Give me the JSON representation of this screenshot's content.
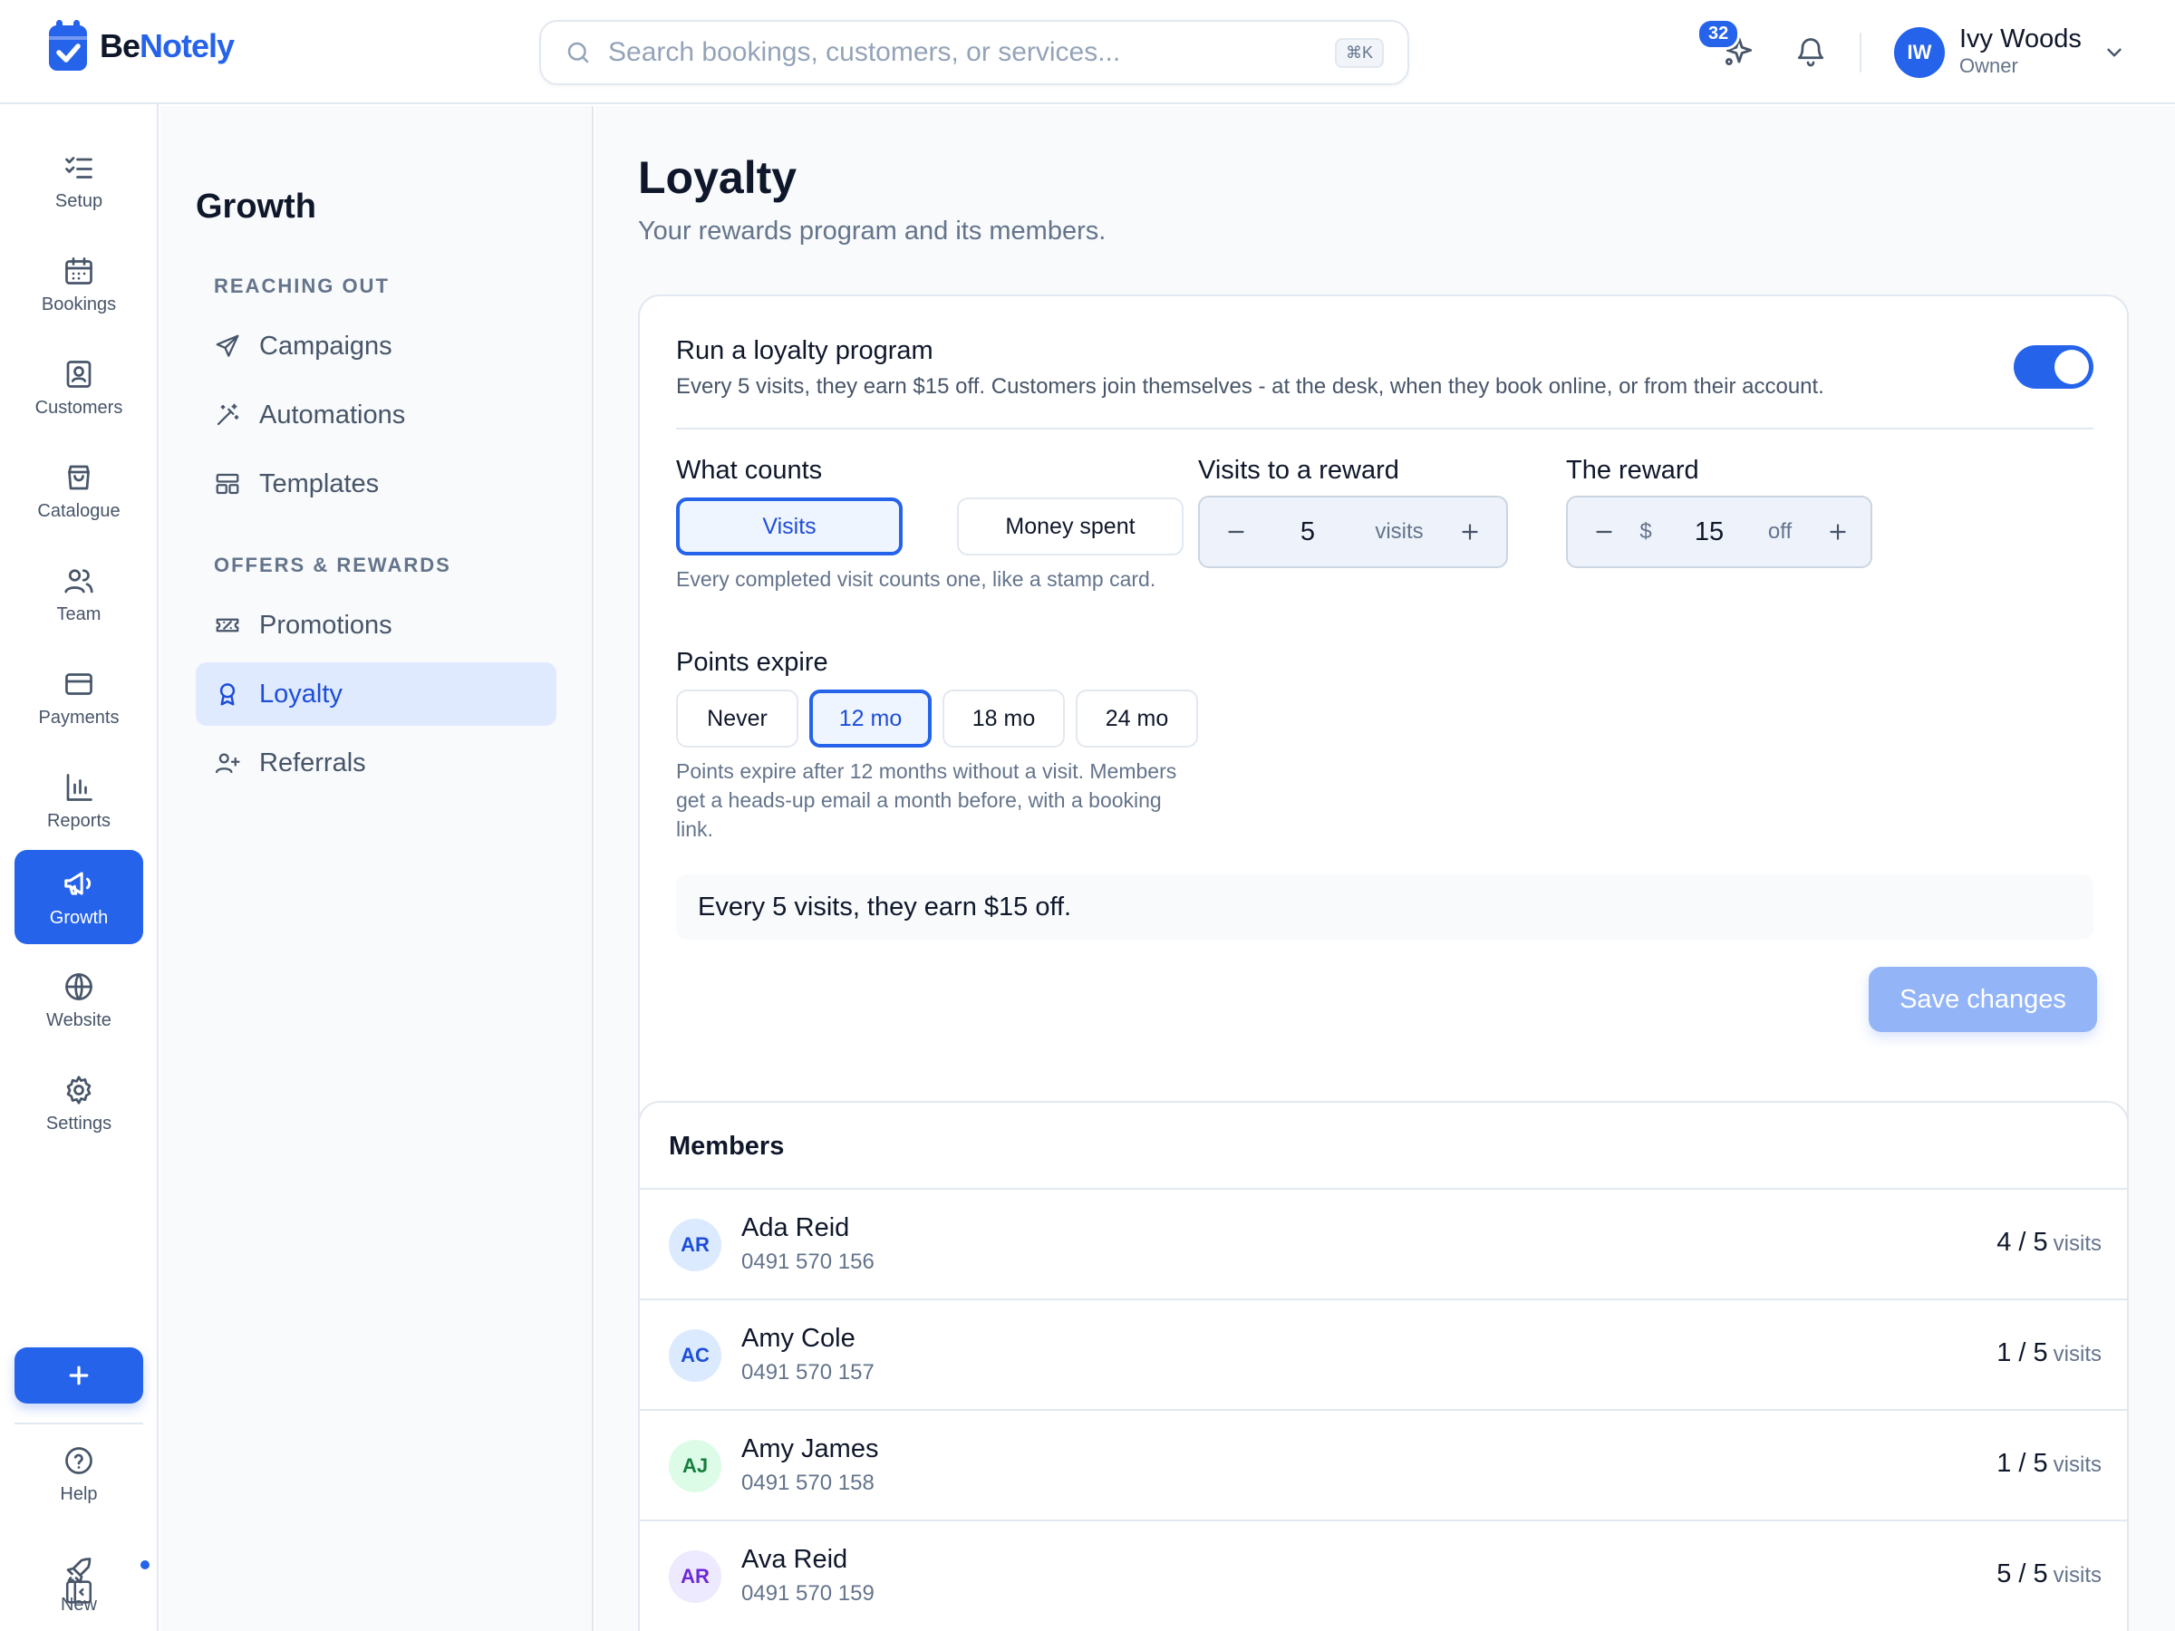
{
  "brand": {
    "name_part1": "Be",
    "name_part2": "Notely"
  },
  "search": {
    "placeholder": "Search bookings, customers, or services...",
    "shortcut": "⌘K"
  },
  "header": {
    "notification_count": "32",
    "user": {
      "initials": "IW",
      "name": "Ivy Woods",
      "role": "Owner"
    }
  },
  "rail": {
    "items": [
      {
        "label": "Setup",
        "icon": "checklist-icon"
      },
      {
        "label": "Bookings",
        "icon": "calendar-icon"
      },
      {
        "label": "Customers",
        "icon": "contact-card-icon"
      },
      {
        "label": "Catalogue",
        "icon": "shopping-bag-icon"
      },
      {
        "label": "Team",
        "icon": "users-icon"
      },
      {
        "label": "Payments",
        "icon": "credit-card-icon"
      },
      {
        "label": "Reports",
        "icon": "bar-chart-icon"
      },
      {
        "label": "Growth",
        "icon": "megaphone-icon",
        "active": true
      },
      {
        "label": "Website",
        "icon": "globe-icon"
      },
      {
        "label": "Settings",
        "icon": "gear-icon"
      }
    ],
    "help_label": "Help",
    "new_label": "New"
  },
  "subnav": {
    "title": "Growth",
    "sections": [
      {
        "label": "REACHING OUT",
        "items": [
          "Campaigns",
          "Automations",
          "Templates"
        ]
      },
      {
        "label": "OFFERS & REWARDS",
        "items": [
          "Promotions",
          "Loyalty",
          "Referrals"
        ]
      }
    ],
    "active": "Loyalty"
  },
  "page": {
    "title": "Loyalty",
    "subtitle": "Your rewards program and its members."
  },
  "program": {
    "title": "Run a loyalty program",
    "description": "Every 5 visits, they earn $15 off. Customers join themselves - at the desk, when they book online, or from their account.",
    "enabled": true,
    "what_counts": {
      "label": "What counts",
      "options": [
        "Visits",
        "Money spent"
      ],
      "selected": "Visits",
      "help": "Every completed visit counts one, like a stamp card."
    },
    "visits_to_reward": {
      "label": "Visits to a reward",
      "value": "5",
      "unit": "visits"
    },
    "reward": {
      "label": "The reward",
      "prefix": "$",
      "value": "15",
      "unit": "off"
    },
    "points_expire": {
      "label": "Points expire",
      "options": [
        "Never",
        "12 mo",
        "18 mo",
        "24 mo"
      ],
      "selected": "12 mo",
      "help": "Points expire after 12 months without a visit. Members get a heads-up email a month before, with a booking link."
    },
    "summary": "Every 5 visits, they earn $15 off.",
    "save_label": "Save changes"
  },
  "members": {
    "title": "Members",
    "unit": "visits",
    "rows": [
      {
        "initials": "AR",
        "name": "Ada Reid",
        "phone": "0491 570 156",
        "count": "4 / 5",
        "color": "#dbeafe",
        "fg": "#1d4ed8"
      },
      {
        "initials": "AC",
        "name": "Amy Cole",
        "phone": "0491 570 157",
        "count": "1 / 5",
        "color": "#dbeafe",
        "fg": "#1d4ed8"
      },
      {
        "initials": "AJ",
        "name": "Amy James",
        "phone": "0491 570 158",
        "count": "1 / 5",
        "color": "#dcfce7",
        "fg": "#15803d"
      },
      {
        "initials": "AR",
        "name": "Ava Reid",
        "phone": "0491 570 159",
        "count": "5 / 5",
        "color": "#ede9fe",
        "fg": "#6d28d9"
      }
    ]
  },
  "colors": {
    "accent": "#2563eb",
    "accent_light": "#e0eaff",
    "border": "#e2e8f0",
    "muted": "#64748b"
  }
}
